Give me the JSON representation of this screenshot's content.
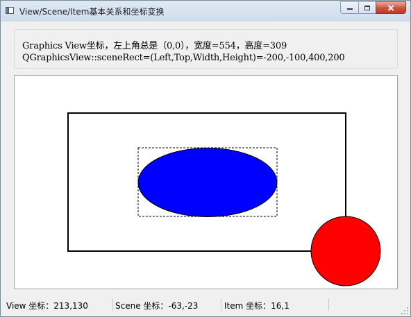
{
  "window": {
    "title": "View/Scene/Item基本关系和坐标变换",
    "icons": {
      "app": "app-window-icon",
      "minimize": "minimize-icon",
      "maximize": "maximize-icon",
      "close": "close-icon"
    }
  },
  "info": {
    "line1": "Graphics View坐标，左上角总是（0,0），宽度=554，高度=309",
    "line2": "QGraphicsView::sceneRect=(Left,Top,Width,Height)=-200,-100,400,200"
  },
  "scene": {
    "rect_color": "#000000",
    "ellipse_color": "#0000ff",
    "circle_color": "#ff0000",
    "background": "#ffffff"
  },
  "status": {
    "view": "View 坐标：213,130",
    "scene": "Scene 坐标：-63,-23",
    "item": "Item 坐标：16,1"
  }
}
